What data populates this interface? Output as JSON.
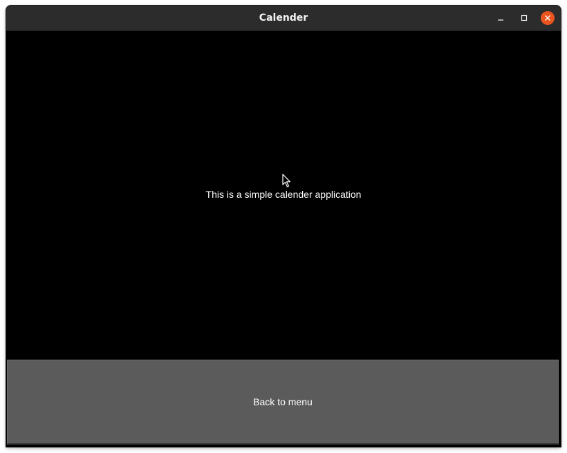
{
  "window": {
    "title": "Calender",
    "controls": {
      "minimize_icon": "minimize-icon",
      "maximize_icon": "maximize-icon",
      "close_icon": "close-icon",
      "close_color": "#e9541f"
    }
  },
  "main": {
    "message": "This is a simple calender application",
    "back_button_label": "Back to menu"
  },
  "colors": {
    "background": "#000000",
    "titlebar": "#2c2c2c",
    "button": "#5b5b5b",
    "text": "#ffffff"
  }
}
